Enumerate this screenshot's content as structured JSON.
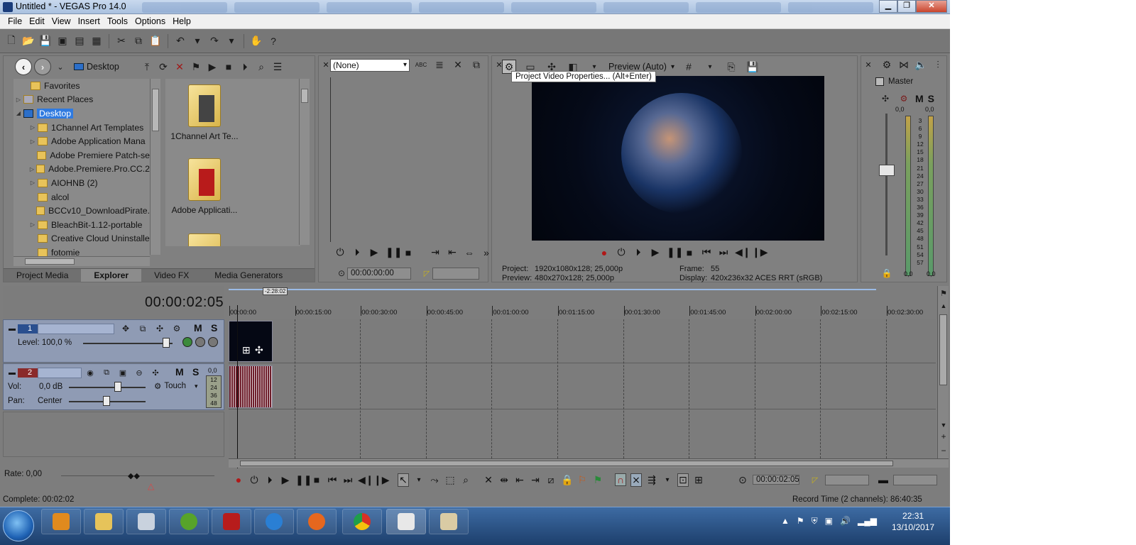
{
  "window": {
    "title": "Untitled * - VEGAS Pro 14.0"
  },
  "menu": [
    "File",
    "Edit",
    "View",
    "Insert",
    "Tools",
    "Options",
    "Help"
  ],
  "explorer": {
    "location": "Desktop",
    "tree": [
      {
        "label": "Favorites",
        "indent": 1,
        "twisty": ""
      },
      {
        "label": "Recent Places",
        "indent": 0,
        "twisty": "▷"
      },
      {
        "label": "Desktop",
        "indent": 0,
        "twisty": "◢",
        "selected": true
      },
      {
        "label": "1Channel Art Templates",
        "indent": 2,
        "twisty": "▷"
      },
      {
        "label": "Adobe Application Mana",
        "indent": 2,
        "twisty": "▷"
      },
      {
        "label": "Adobe Premiere Patch-se",
        "indent": 2,
        "twisty": ""
      },
      {
        "label": "Adobe.Premiere.Pro.CC.2",
        "indent": 2,
        "twisty": "▷"
      },
      {
        "label": "AIOHNB (2)",
        "indent": 2,
        "twisty": "▷"
      },
      {
        "label": "alcol",
        "indent": 2,
        "twisty": ""
      },
      {
        "label": "BCCv10_DownloadPirate.",
        "indent": 2,
        "twisty": ""
      },
      {
        "label": "BleachBit-1.12-portable",
        "indent": 2,
        "twisty": "▷"
      },
      {
        "label": "Creative Cloud Uninstalle",
        "indent": 2,
        "twisty": ""
      },
      {
        "label": "fotomie",
        "indent": 2,
        "twisty": ""
      }
    ],
    "files": [
      "1Channel Art Te...",
      "Adobe Applicati..."
    ],
    "tabs": [
      "Project Media",
      "Explorer",
      "Video FX",
      "Media Generators"
    ]
  },
  "trimmer": {
    "source": "(None)",
    "timecode": "00:00:00:00"
  },
  "preview": {
    "mode": "Preview (Auto)",
    "tooltip": "Project Video Properties... (Alt+Enter)",
    "info": {
      "project_label": "Project:",
      "project": "1920x1080x128; 25,000p",
      "preview_label": "Preview:",
      "preview": "480x270x128; 25,000p",
      "frame_label": "Frame:",
      "frame": "55",
      "display_label": "Display:",
      "display": "420x236x32 ACES RRT (sRGB)"
    }
  },
  "mixer": {
    "title": "Master",
    "left_level": "0,0",
    "right_level": "0,0",
    "bottom_left": "0,0",
    "bottom_right": "0,0",
    "scale": [
      "3",
      "6",
      "9",
      "12",
      "15",
      "18",
      "21",
      "24",
      "27",
      "30",
      "33",
      "36",
      "39",
      "42",
      "45",
      "48",
      "51",
      "54",
      "57"
    ]
  },
  "timeline": {
    "timecode": "00:00:02:05",
    "loop_label": "-2:28:02",
    "ruler": [
      "00:00:00",
      "00:00:15:00",
      "00:00:30:00",
      "00:00:45:00",
      "00:01:00:00",
      "00:01:15:00",
      "00:01:30:00",
      "00:01:45:00",
      "00:02:00:00",
      "00:02:15:00",
      "00:02:30:00"
    ],
    "video_track": {
      "number": "1",
      "level_label": "Level: 100,0 %",
      "level": 1.0
    },
    "audio_track": {
      "number": "2",
      "vol_label": "Vol:",
      "vol": "0,0 dB",
      "pan_label": "Pan:",
      "pan": "Center",
      "automation": "Touch",
      "meter_top": "0,0",
      "meter_scale": [
        "12",
        "24",
        "36",
        "48"
      ]
    },
    "rate": "Rate: 0,00",
    "position": "00:00:02:05"
  },
  "status": {
    "left": "Complete: 00:02:02",
    "right": "Record Time (2 channels): 86:40:35"
  },
  "taskbar": {
    "apps": [
      "media-player",
      "explorer",
      "calculator",
      "utorrent",
      "acrobat",
      "internet-explorer",
      "firefox",
      "chrome",
      "vegas",
      "paint"
    ],
    "time": "22:31",
    "date": "13/10/2017"
  }
}
